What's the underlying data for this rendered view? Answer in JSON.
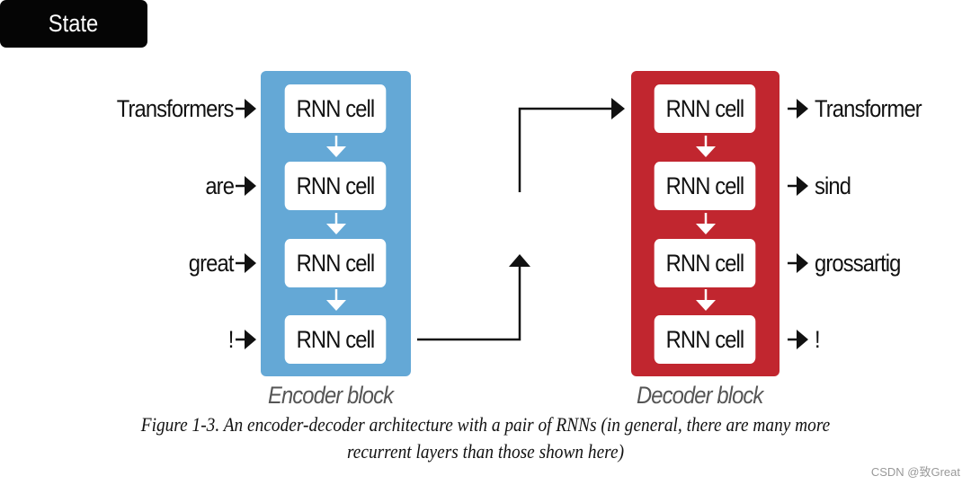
{
  "encoder": {
    "caption": "Encoder block",
    "color": "#64a8d6",
    "inputs": [
      "Transformers",
      "are",
      "great",
      "!"
    ],
    "cells": [
      "RNN cell",
      "RNN cell",
      "RNN cell",
      "RNN cell"
    ]
  },
  "decoder": {
    "caption": "Decoder block",
    "color": "#c1262f",
    "outputs": [
      "Transformer",
      "sind",
      "grossartig",
      "!"
    ],
    "cells": [
      "RNN cell",
      "RNN cell",
      "RNN cell",
      "RNN cell"
    ]
  },
  "state": {
    "label": "State",
    "color": "#050505"
  },
  "figure_caption": {
    "line1": "Figure 1-3. An encoder-decoder architecture with a pair of RNNs (in general, there are many more",
    "line2": "recurrent layers than those shown here)"
  },
  "watermark": "CSDN @致Great"
}
